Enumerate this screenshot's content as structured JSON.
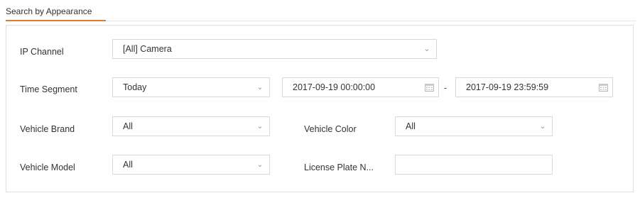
{
  "tab": {
    "label": "Search by Appearance"
  },
  "form": {
    "ip_channel": {
      "label": "IP Channel",
      "value": "[All] Camera"
    },
    "time_segment": {
      "label": "Time Segment",
      "value": "Today",
      "start": "2017-09-19 00:00:00",
      "separator": "-",
      "end": "2017-09-19 23:59:59"
    },
    "vehicle_brand": {
      "label": "Vehicle Brand",
      "value": "All"
    },
    "vehicle_color": {
      "label": "Vehicle Color",
      "value": "All"
    },
    "vehicle_model": {
      "label": "Vehicle Model",
      "value": "All"
    },
    "license_plate": {
      "label": "License Plate N...",
      "value": ""
    }
  },
  "icons": {
    "dropdown": "chevron-down-icon",
    "calendar": "calendar-icon"
  },
  "colors": {
    "accent": "#e07b2e",
    "border": "#d9d9d9"
  }
}
